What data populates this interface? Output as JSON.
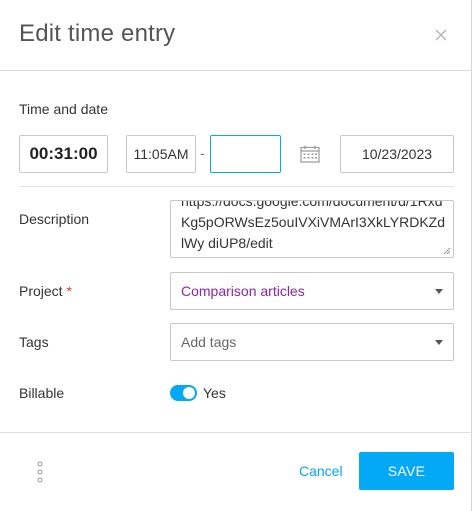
{
  "header": {
    "title": "Edit time entry",
    "close_icon": "close-icon"
  },
  "time_section": {
    "label": "Time and date",
    "duration": "00:31:00",
    "start_time": "11:05AM",
    "separator": "-",
    "end_time": "",
    "calendar_icon": "calendar-icon",
    "date": "10/23/2023"
  },
  "description": {
    "label": "Description",
    "value": "https://docs.google.com/document/d/1Rxd Kg5pORWsEz5ouIVXiVMArI3XkLYRDKZdlWy diUP8/edit"
  },
  "project": {
    "label": "Project",
    "required_mark": "*",
    "value": "Comparison articles",
    "value_color": "#8e24aa"
  },
  "tags": {
    "label": "Tags",
    "placeholder": "Add tags"
  },
  "billable": {
    "label": "Billable",
    "state_text": "Yes",
    "enabled": true
  },
  "footer": {
    "more_icon": "more-vertical-icon",
    "cancel_label": "Cancel",
    "save_label": "SAVE"
  },
  "colors": {
    "accent": "#03a9f4",
    "required": "#e53935"
  }
}
